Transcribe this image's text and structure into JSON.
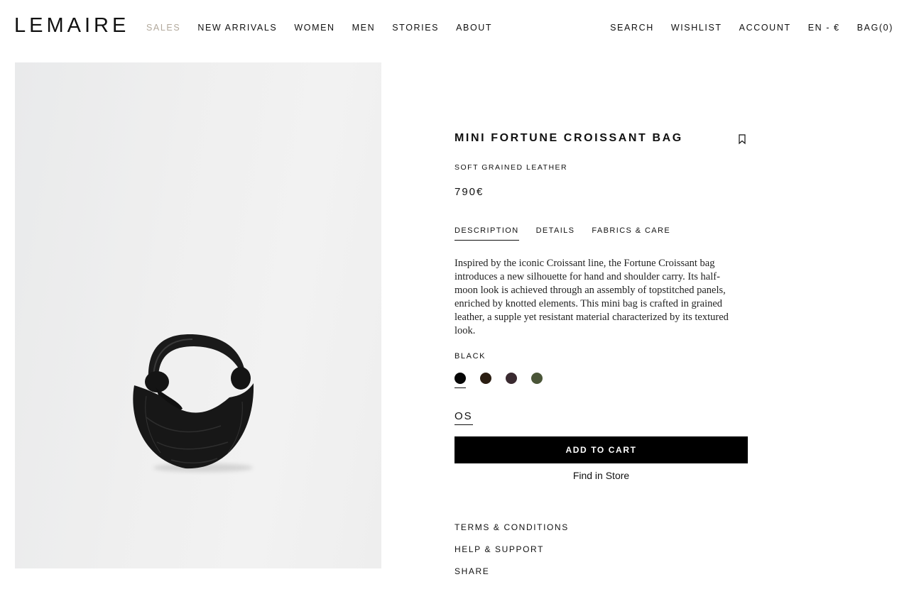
{
  "header": {
    "logo": "LEMAIRE",
    "nav_left": [
      {
        "label": "SALES",
        "highlight_color": "#b2a99c"
      },
      {
        "label": "NEW ARRIVALS"
      },
      {
        "label": "WOMEN"
      },
      {
        "label": "MEN"
      },
      {
        "label": "STORIES"
      },
      {
        "label": "ABOUT"
      }
    ],
    "nav_right": [
      {
        "label": "SEARCH"
      },
      {
        "label": "WISHLIST"
      },
      {
        "label": "ACCOUNT"
      },
      {
        "label": "EN - €"
      },
      {
        "label": "BAG(0)"
      }
    ]
  },
  "product": {
    "title": "MINI FORTUNE CROISSANT BAG",
    "material": "SOFT GRAINED LEATHER",
    "price": "790€",
    "tabs": [
      {
        "label": "DESCRIPTION",
        "active": true
      },
      {
        "label": "DETAILS",
        "active": false
      },
      {
        "label": "FABRICS & CARE",
        "active": false
      }
    ],
    "description": "Inspired by the iconic Croissant line, the Fortune Croissant bag introduces a new silhouette for hand and shoulder carry. Its half-moon look is achieved through an assembly of topstitched panels, enriched by knotted elements. This mini bag is crafted in grained leather, a supple yet resistant material characterized by its textured look.",
    "selected_color": "BLACK",
    "colors": [
      "#050505",
      "#2b1e12",
      "#3a2a30",
      "#4a5538"
    ],
    "size": "OS",
    "add_to_cart": "ADD TO CART",
    "find_in_store": "Find in Store",
    "wishlist_icon": "bookmark-icon"
  },
  "footer_links": [
    "TERMS & CONDITIONS",
    "HELP & SUPPORT",
    "SHARE"
  ]
}
